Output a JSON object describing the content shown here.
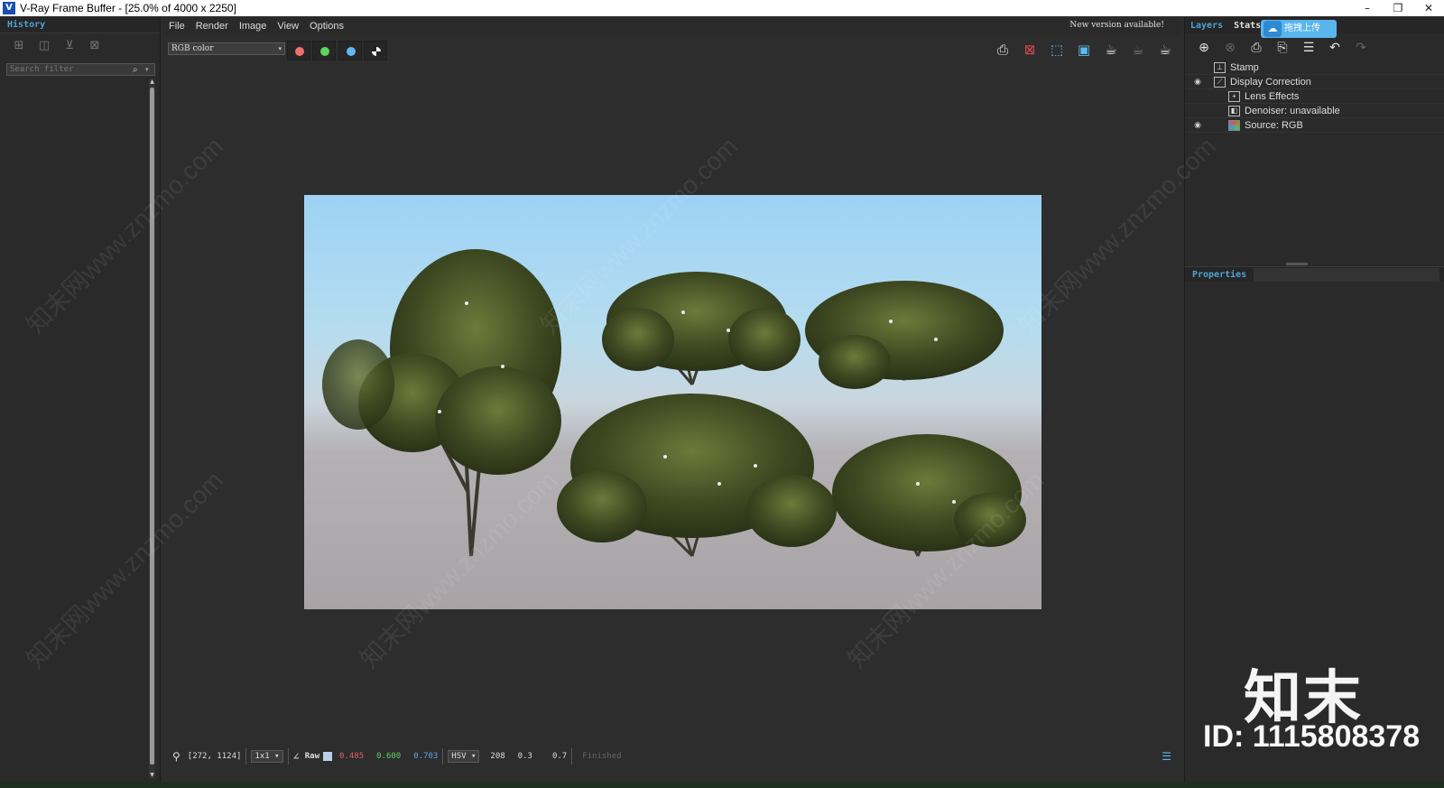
{
  "window": {
    "title": "V-Ray Frame Buffer - [25.0% of 4000 x 2250]",
    "app_icon_glyph": "V",
    "controls": [
      "–",
      "❐",
      "✕"
    ]
  },
  "history": {
    "header": "History",
    "icons": [
      "save-history-icon",
      "compare-ab-icon",
      "load-history-icon",
      "delete-history-icon"
    ],
    "search_placeholder": "Search filter"
  },
  "menu": {
    "items": [
      "File",
      "Render",
      "Image",
      "View",
      "Options"
    ],
    "notice": "New version available!"
  },
  "toolbar": {
    "channel": "RGB color",
    "channel_buttons": [
      {
        "name": "red-channel",
        "color": "#f07070"
      },
      {
        "name": "green-channel",
        "color": "#5fd45f"
      },
      {
        "name": "blue-channel",
        "color": "#5fb8f0"
      }
    ],
    "right_icons": [
      "save-image-icon",
      "clear-image-icon",
      "region-render-icon",
      "track-mouse-icon",
      "render-icon",
      "interactive-render-icon",
      "stop-render-icon"
    ]
  },
  "status": {
    "coords": "[272, 1124]",
    "zoom_mode": "1x1",
    "raw_label": "Raw",
    "r": "0.485",
    "g": "0.600",
    "b": "0.703",
    "color_mode": "HSV",
    "h": "208",
    "s": "0.3",
    "v": "0.7",
    "state": "Finished"
  },
  "layers": {
    "tabs": [
      "Layers",
      "Stats"
    ],
    "upload_button": "拖拽上传",
    "items": [
      {
        "label": "Stamp",
        "visible": false,
        "icon": "stamp-icon",
        "indent": 0
      },
      {
        "label": "Display Correction",
        "visible": true,
        "icon": "curve-icon",
        "indent": 0
      },
      {
        "label": "Lens Effects",
        "visible": false,
        "icon": "lens-effects-icon",
        "indent": 1
      },
      {
        "label": "Denoiser: unavailable",
        "visible": false,
        "icon": "denoiser-icon",
        "indent": 1
      },
      {
        "label": "Source: RGB",
        "visible": true,
        "icon": "source-rgb-icon",
        "indent": 1
      }
    ],
    "properties_header": "Properties"
  },
  "watermark": {
    "logo": "知末",
    "id": "ID: 1115808378",
    "repeat_text": "知末网www.znzmo.com"
  }
}
